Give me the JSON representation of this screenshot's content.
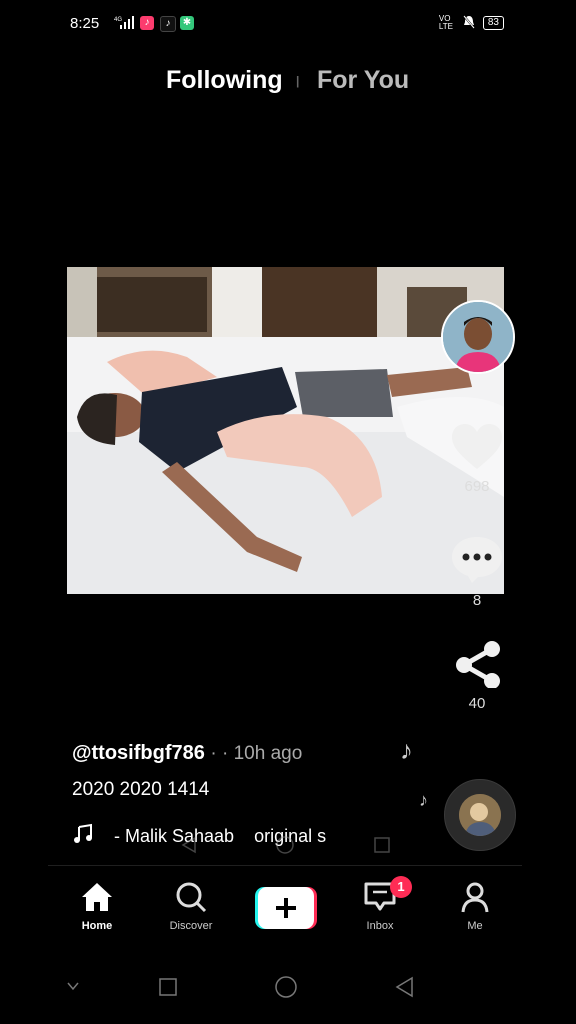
{
  "status_bar": {
    "time": "8:25",
    "signal": "4G",
    "volte": "VO LTE",
    "battery": "83"
  },
  "top_tabs": {
    "following": "Following",
    "for_you": "For You"
  },
  "side_actions": {
    "likes": "698",
    "comments": "8",
    "shares": "40"
  },
  "post": {
    "username": "@ttosifbgf786",
    "time_ago": "· · 10h ago",
    "caption": "2020 2020 1414",
    "music": "- Malik Sahaab    original s"
  },
  "bottom_nav": {
    "home": "Home",
    "discover": "Discover",
    "inbox": "Inbox",
    "inbox_badge": "1",
    "me": "Me"
  },
  "colors": {
    "accent_red": "#fe2c55",
    "accent_cyan": "#25f4ee"
  }
}
